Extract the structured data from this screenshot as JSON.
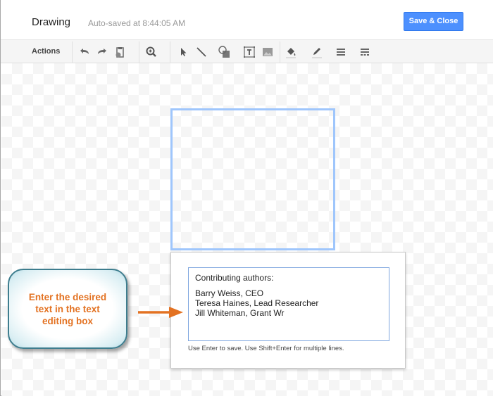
{
  "header": {
    "title": "Drawing",
    "autosave_status": "Auto-saved at 8:44:05 AM",
    "save_close_label": "Save & Close"
  },
  "toolbar": {
    "actions_label": "Actions",
    "icons": [
      "undo-icon",
      "redo-icon",
      "paste-format-icon",
      "zoom-icon",
      "select-icon",
      "line-icon",
      "shape-icon",
      "text-box-icon",
      "image-icon",
      "fill-color-icon",
      "line-color-icon",
      "line-weight-icon",
      "line-dash-icon"
    ]
  },
  "colors": {
    "accent": "#4d90fe",
    "selection_border": "#9fc6fc",
    "callout_text": "#e37222",
    "arrow": "#e37222"
  },
  "editor": {
    "lines": [
      "Contributing authors:",
      "",
      "Barry Weiss, CEO",
      "Teresa Haines, Lead Researcher",
      "Jill Whiteman, Grant Wr"
    ],
    "hint": "Use Enter to save. Use Shift+Enter for multiple lines."
  },
  "callout": {
    "lines": [
      "Enter the desired",
      "text in the text",
      "editing box"
    ]
  }
}
